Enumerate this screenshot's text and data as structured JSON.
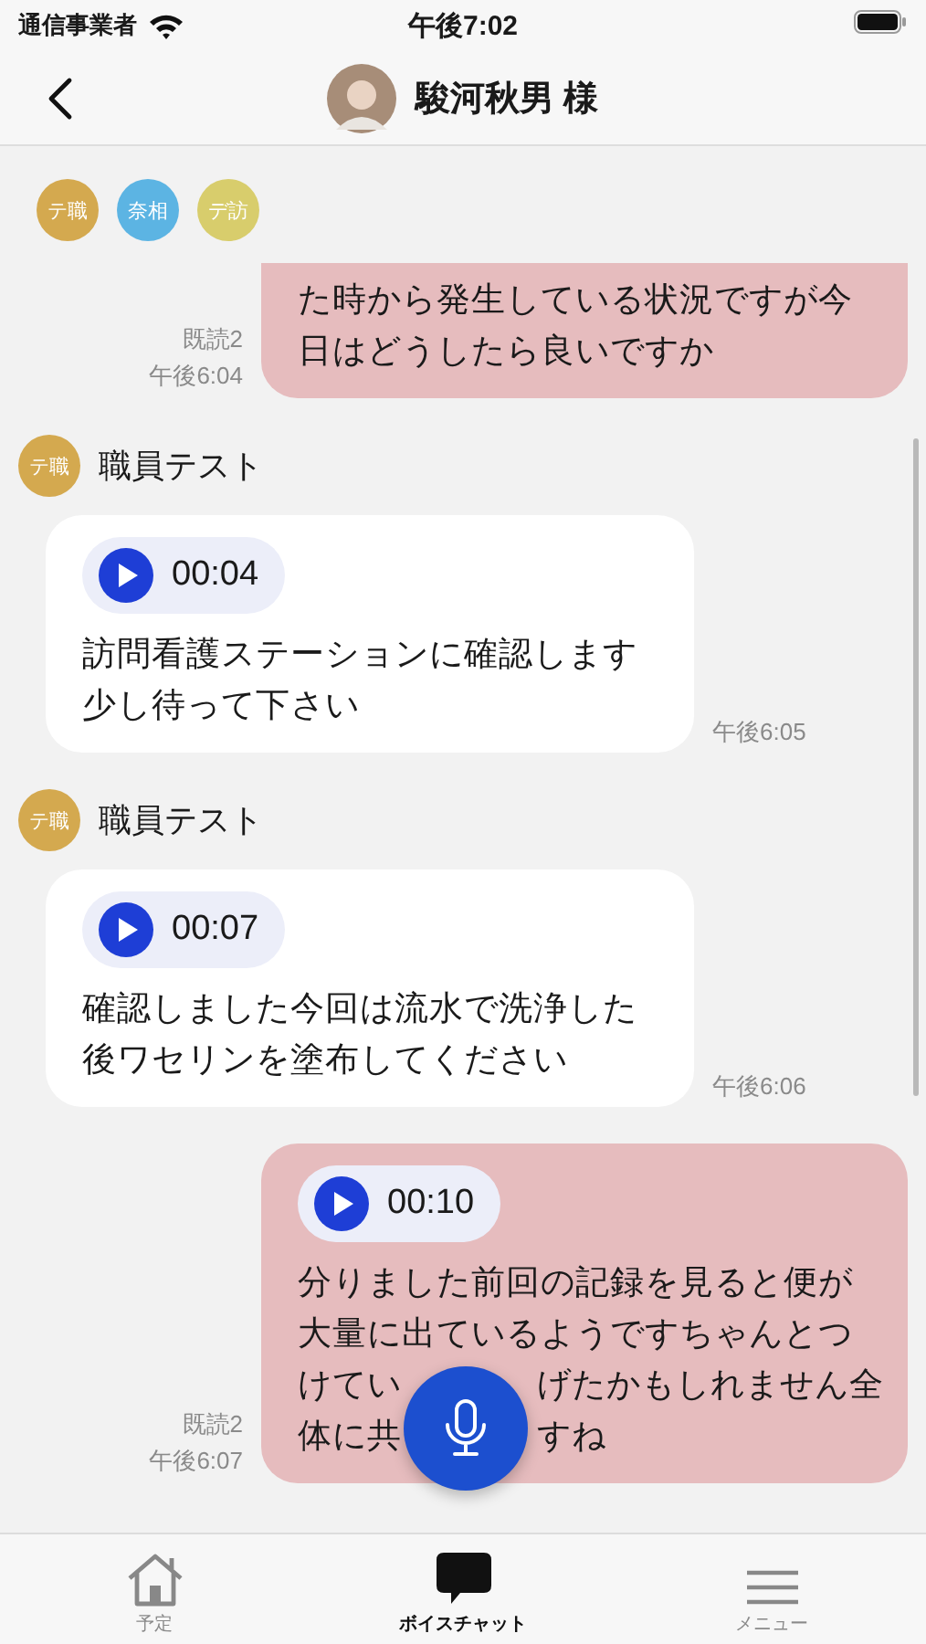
{
  "status_bar": {
    "carrier": "通信事業者",
    "time": "午後7:02"
  },
  "header": {
    "title": "駿河秋男 様"
  },
  "members": [
    {
      "label": "テ職",
      "color": "#d4a94f"
    },
    {
      "label": "奈相",
      "color": "#5cb4e3"
    },
    {
      "label": "デ訪",
      "color": "#d8cd6c"
    }
  ],
  "messages": [
    {
      "kind": "sent",
      "read": "既読2",
      "time": "午後6:04",
      "lines": [
        [
          "た時から発生している状況ですが今"
        ],
        [
          "日はどうしたら良いですか"
        ]
      ]
    },
    {
      "kind": "received",
      "avatar": {
        "label": "テ職",
        "color": "#d4a94f"
      },
      "sender": "職員テスト",
      "duration": "00:04",
      "time": "午後6:05",
      "lines": [
        [
          "訪問看護ステーションに確認します"
        ],
        [
          "少し待って下さい"
        ]
      ]
    },
    {
      "kind": "received",
      "avatar": {
        "label": "テ職",
        "color": "#d4a94f"
      },
      "sender": "職員テスト",
      "duration": "00:07",
      "time": "午後6:06",
      "lines": [
        [
          "確認しました今回は流水で洗浄した"
        ],
        [
          "後ワセリンを塗布してください"
        ]
      ]
    },
    {
      "kind": "sent",
      "read": "既読2",
      "time": "午後6:07",
      "duration": "00:10",
      "lines": [
        [
          "分りました前回の記録を見ると便が"
        ],
        [
          "大量に出ているようですちゃんとつ"
        ],
        [
          "けてい",
          "げたかもしれません全"
        ],
        [
          "体に共",
          "すね"
        ]
      ]
    }
  ],
  "tabs": [
    {
      "label": "予定",
      "kind": "home",
      "selected": false
    },
    {
      "label": "ボイスチャット",
      "kind": "chat",
      "selected": true
    },
    {
      "label": "メニュー",
      "kind": "menu",
      "selected": false
    }
  ]
}
